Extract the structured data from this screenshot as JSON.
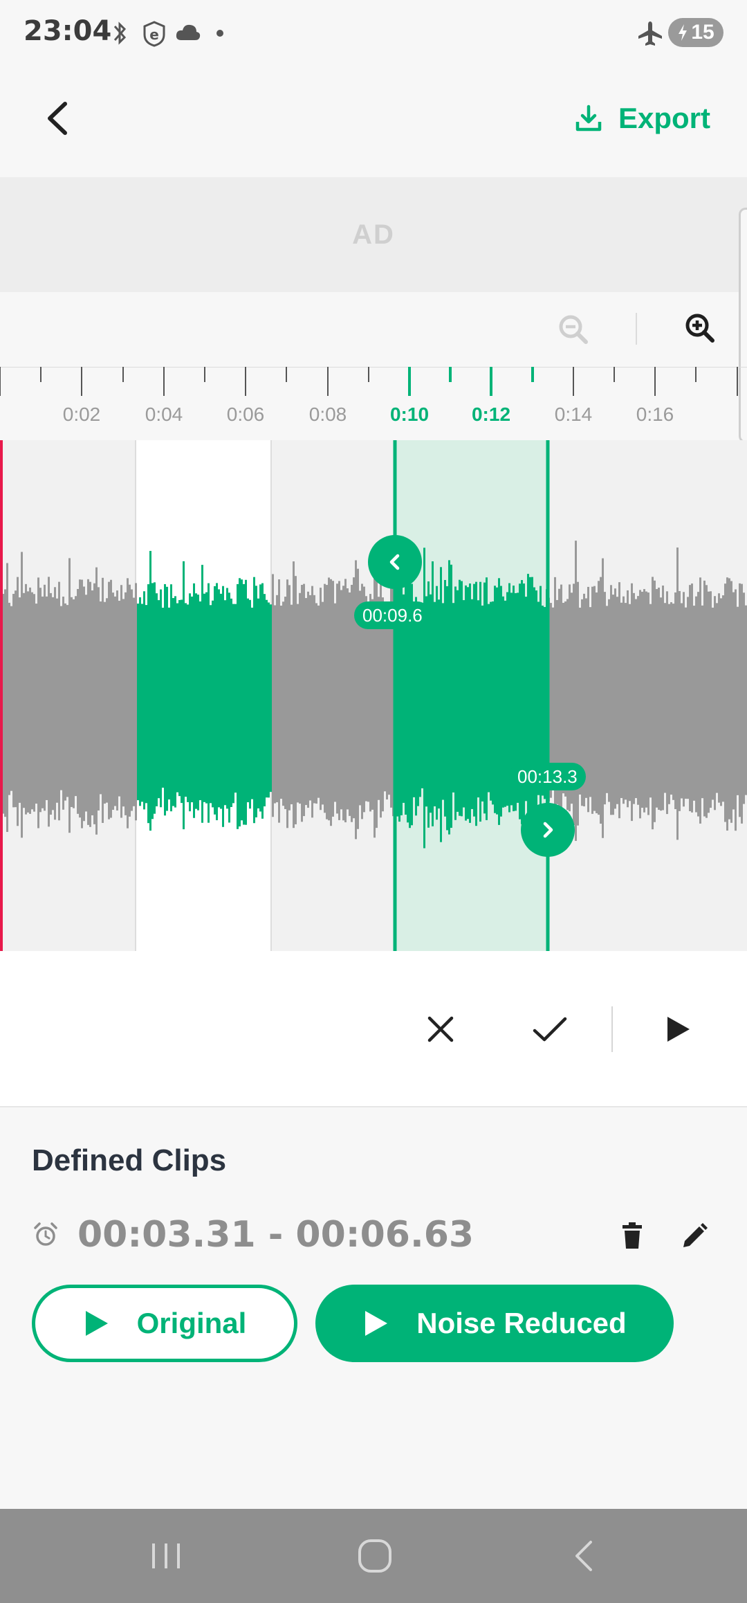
{
  "status_bar": {
    "time": "23:04",
    "battery": "15",
    "icons": [
      "bluetooth-icon",
      "vpn-icon",
      "cloud-icon",
      "dot-icon",
      "airplane-icon",
      "battery-charging-icon"
    ]
  },
  "header": {
    "back_icon": "chevron-left-icon",
    "export_label": "Export",
    "export_icon": "download-icon"
  },
  "ad": {
    "label": "AD"
  },
  "zoom": {
    "zoom_out_icon": "zoom-out-icon",
    "zoom_in_icon": "zoom-in-icon"
  },
  "timeline": {
    "tick_labels": [
      "0:02",
      "0:04",
      "0:06",
      "0:08",
      "0:10",
      "0:12",
      "0:14",
      "0:16"
    ],
    "active_labels": [
      "0:10",
      "0:12"
    ]
  },
  "selection": {
    "start_time": "00:09.6",
    "end_time": "00:13.3"
  },
  "actions": {
    "cancel_icon": "close-icon",
    "confirm_icon": "check-icon",
    "play_icon": "play-icon"
  },
  "clips": {
    "title": "Defined Clips",
    "items": [
      {
        "range": "00:03.31 - 00:06.63"
      }
    ],
    "original_label": "Original",
    "noise_reduced_label": "Noise Reduced"
  },
  "colors": {
    "accent": "#00b377",
    "selection_fill": "#d9efe5",
    "waveform": "#999999",
    "playhead": "#e8194b"
  }
}
